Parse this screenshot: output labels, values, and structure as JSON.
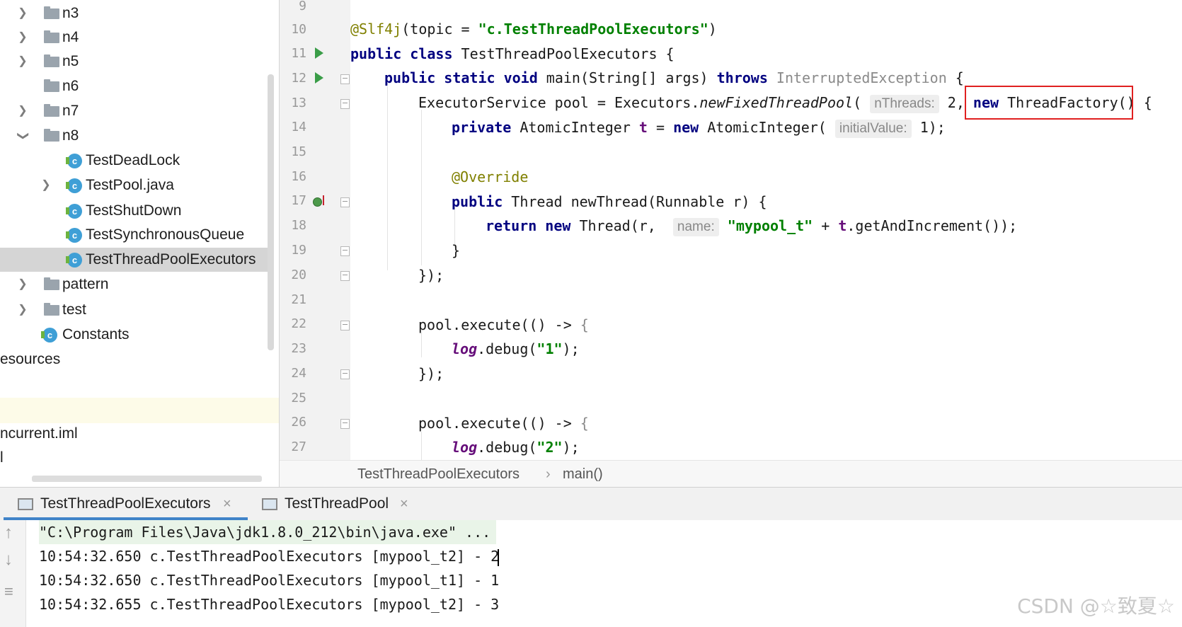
{
  "tree": {
    "items": [
      {
        "label": "n3",
        "type": "folder",
        "expanded": false
      },
      {
        "label": "n4",
        "type": "folder",
        "expanded": false
      },
      {
        "label": "n5",
        "type": "folder",
        "expanded": false
      },
      {
        "label": "n6",
        "type": "folder",
        "expanded": false
      },
      {
        "label": "n7",
        "type": "folder",
        "expanded": false
      },
      {
        "label": "n8",
        "type": "folder",
        "expanded": true
      },
      {
        "label": "TestDeadLock",
        "type": "class"
      },
      {
        "label": "TestPool.java",
        "type": "class"
      },
      {
        "label": "TestShutDown",
        "type": "class"
      },
      {
        "label": "TestSynchronousQueue",
        "type": "class"
      },
      {
        "label": "TestThreadPoolExecutors",
        "type": "class",
        "selected": true
      },
      {
        "label": "pattern",
        "type": "folder"
      },
      {
        "label": "test",
        "type": "folder"
      },
      {
        "label": "Constants",
        "type": "class"
      },
      {
        "label": "esources",
        "type": "text"
      },
      {
        "label": "ncurrent.iml",
        "type": "text"
      },
      {
        "label": "l",
        "type": "text"
      }
    ]
  },
  "editor": {
    "line_numbers": [
      "9",
      "10",
      "11",
      "12",
      "13",
      "14",
      "15",
      "16",
      "17",
      "18",
      "19",
      "20",
      "21",
      "22",
      "23",
      "24",
      "25",
      "26",
      "27"
    ],
    "hints": {
      "nthreads": "nThreads:",
      "initial_value": "initialValue:",
      "name": "name:"
    },
    "code": {
      "l10_annotation": "@Slf4j",
      "l10_open": "(topic = ",
      "l10_string": "\"c.TestThreadPoolExecutors\"",
      "l10_close": ")",
      "l11_kw": "public class",
      "l11_rest": " TestThreadPoolExecutors {",
      "l12_kw": "public static void",
      "l12_mid": " main(String[] args) ",
      "l12_throws": "throws",
      "l12_exc": " InterruptedException",
      "l12_brace": " {",
      "l13_a": "ExecutorService pool = Executors.",
      "l13_method": "newFixedThreadPool",
      "l13_b": "(",
      "l13_num": " 2,",
      "l13_new": "new",
      "l13_tf": " ThreadFactory()",
      "l13_brace": " {",
      "l14_kw": "private",
      "l14_a": " AtomicInteger ",
      "l14_field": "t",
      "l14_b": " = ",
      "l14_new": "new",
      "l14_c": " AtomicInteger(",
      "l14_d": " 1);",
      "l16": "@Override",
      "l17_kw": "public",
      "l17_rest": " Thread newThread(Runnable r) {",
      "l18_ret": "return new",
      "l18_a": " Thread(r, ",
      "l18_str": "\"mypool_t\"",
      "l18_b": " + ",
      "l18_field": "t",
      "l18_c": ".getAndIncrement());",
      "l19": "}",
      "l20": "});",
      "l22_a": "pool.execute(() -> ",
      "l22_b": "{",
      "l23_log": "log",
      "l23_a": ".debug(",
      "l23_str": "\"1\"",
      "l23_b": ");",
      "l24": "});",
      "l26_a": "pool.execute(() -> ",
      "l26_b": "{",
      "l27_log": "log",
      "l27_a": ".debug(",
      "l27_str": "\"2\"",
      "l27_b": ");"
    }
  },
  "breadcrumb": {
    "class_name": "TestThreadPoolExecutors",
    "separator": "›",
    "method": "main()"
  },
  "run_tabs": [
    {
      "label": "TestThreadPoolExecutors",
      "close": "×",
      "active": true
    },
    {
      "label": "TestThreadPool",
      "close": "×",
      "active": false
    }
  ],
  "console": {
    "command": "\"C:\\Program Files\\Java\\jdk1.8.0_212\\bin\\java.exe\" ...",
    "lines": [
      "10:54:32.650 c.TestThreadPoolExecutors [mypool_t2] - 2",
      "10:54:32.650 c.TestThreadPoolExecutors [mypool_t1] - 1",
      "10:54:32.655 c.TestThreadPoolExecutors [mypool_t2] - 3"
    ],
    "gutter_icons": [
      "arrow-up-icon",
      "arrow-down-icon",
      "soft-wrap-icon"
    ]
  },
  "watermark": "CSDN @☆致夏☆",
  "colors": {
    "keyword": "#000080",
    "string": "#008000",
    "annotation": "#808000",
    "highlight_box": "#e02020",
    "tab_underline": "#4083c9"
  }
}
